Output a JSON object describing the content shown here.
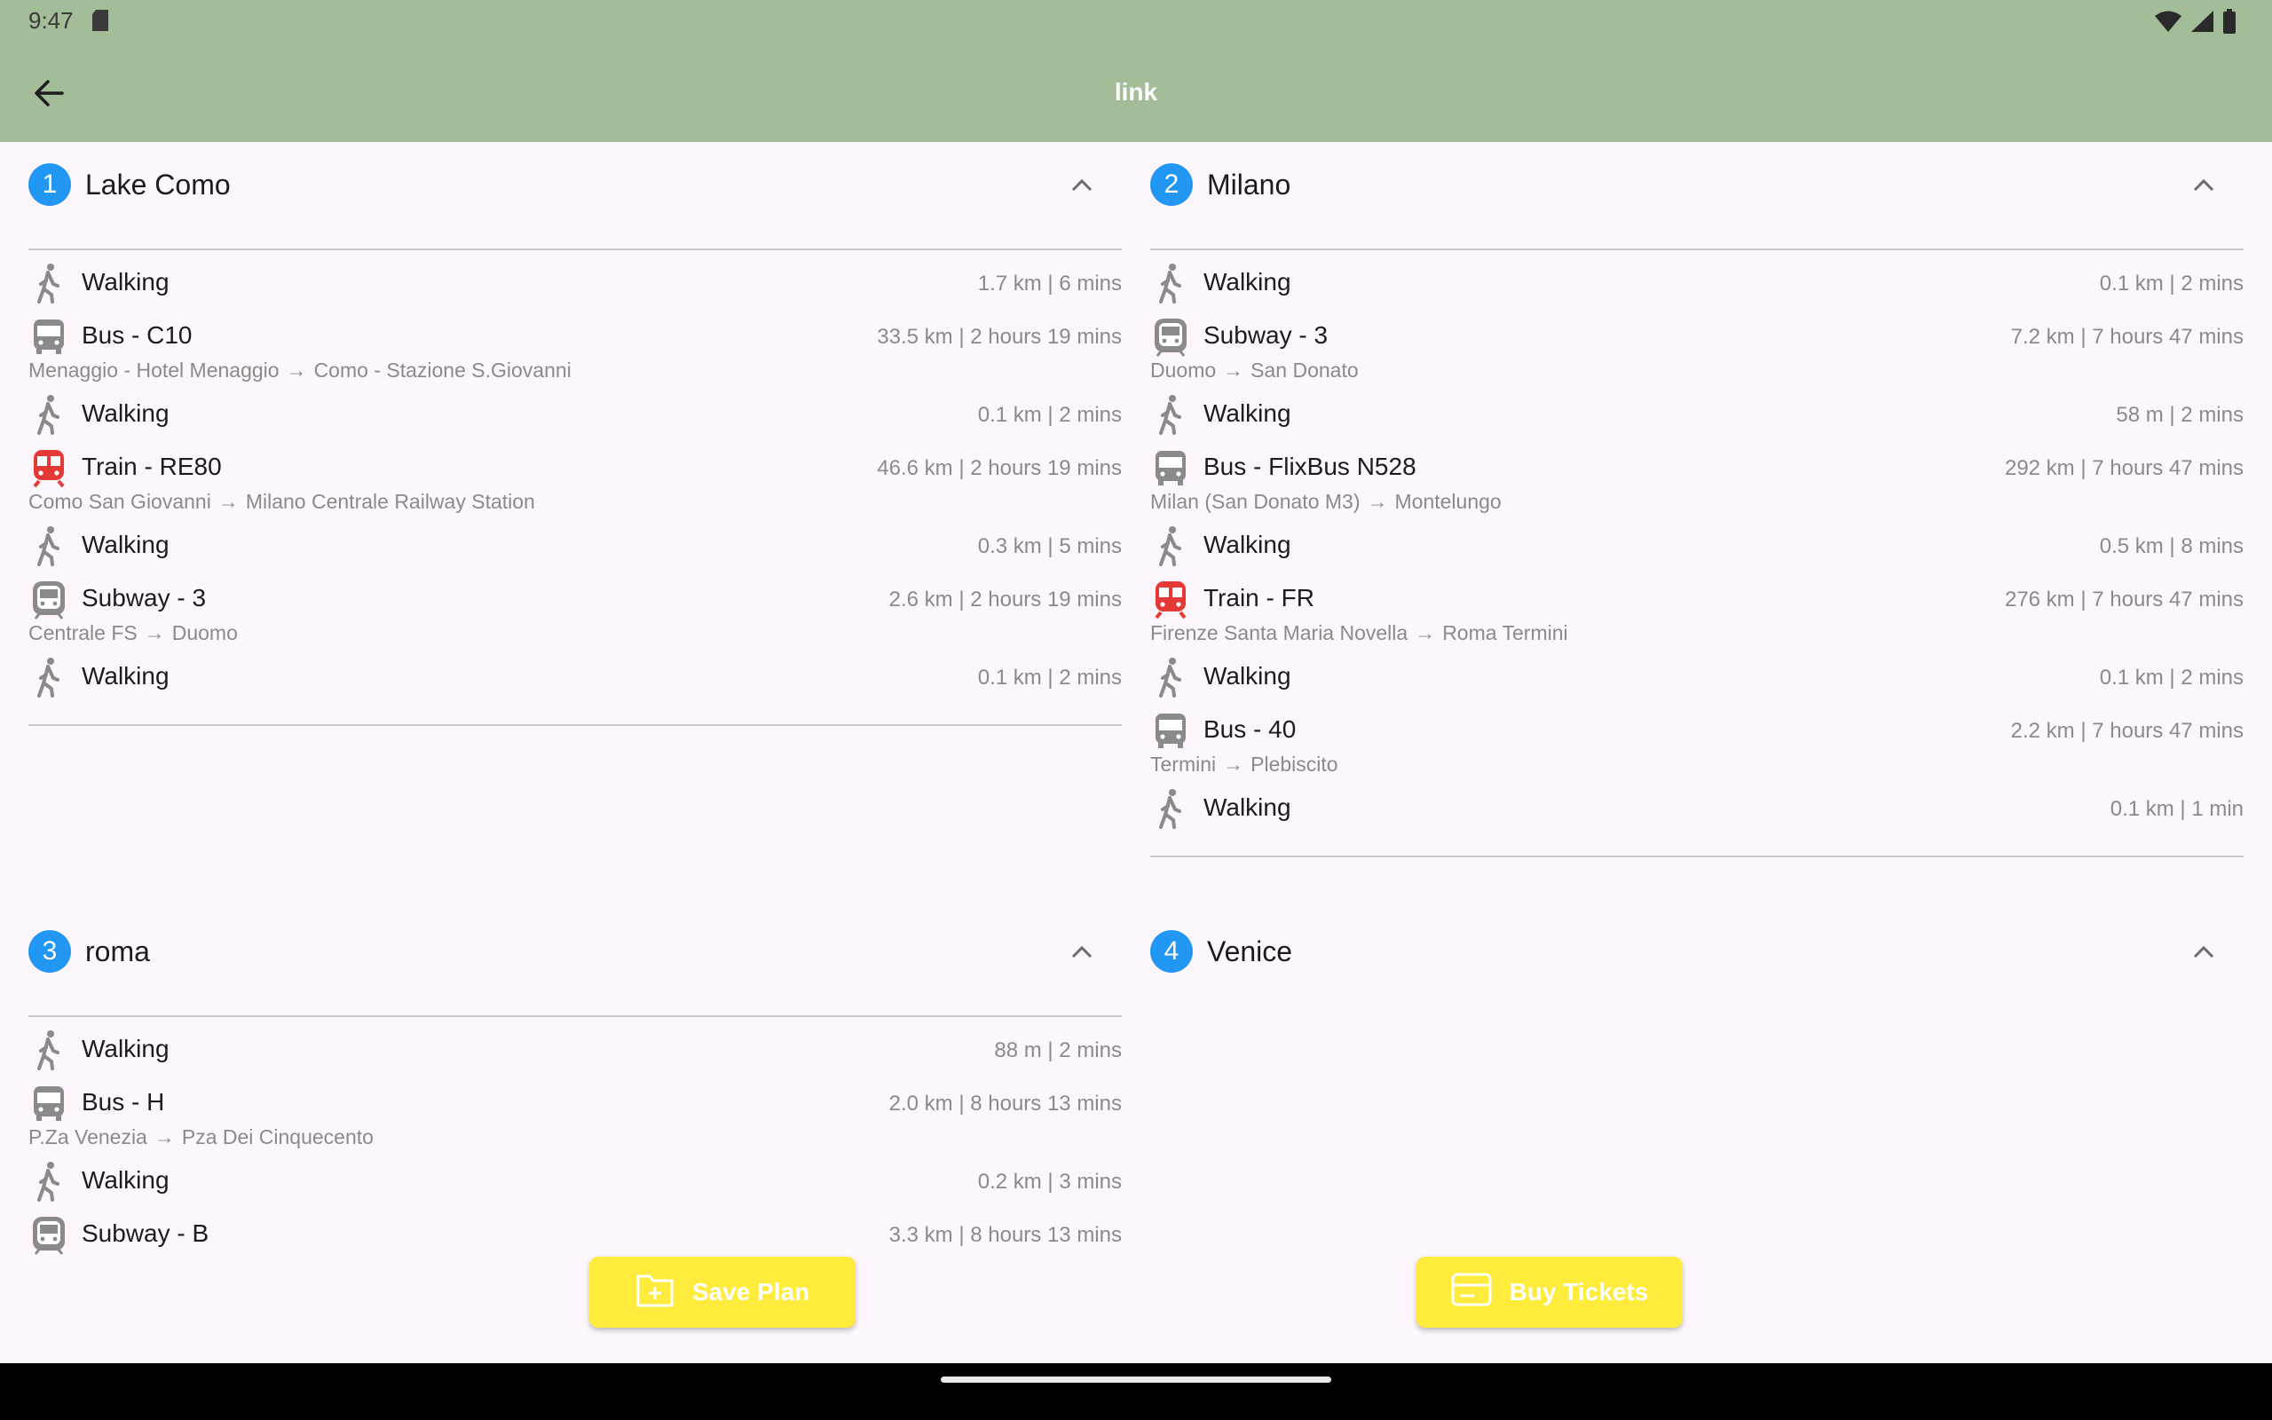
{
  "status_bar": {
    "time": "9:47"
  },
  "app_bar": {
    "title": "link"
  },
  "sections": [
    {
      "number": "1",
      "title": "Lake Como",
      "legs": [
        {
          "icon": "walk-icon",
          "label": "Walking",
          "meta": "1.7 km | 6 mins"
        },
        {
          "icon": "bus-icon",
          "label": "Bus - C10",
          "meta": "33.5 km | 2 hours 19 mins",
          "from": "Menaggio - Hotel Menaggio",
          "to": "Como - Stazione S.Giovanni"
        },
        {
          "icon": "walk-icon",
          "label": "Walking",
          "meta": "0.1 km | 2 mins"
        },
        {
          "icon": "train-icon",
          "label": "Train - RE80",
          "meta": "46.6 km | 2 hours 19 mins",
          "from": "Como San Giovanni",
          "to": "Milano Centrale Railway Station"
        },
        {
          "icon": "walk-icon",
          "label": "Walking",
          "meta": "0.3 km | 5 mins"
        },
        {
          "icon": "subway-icon",
          "label": "Subway - 3",
          "meta": "2.6 km | 2 hours 19 mins",
          "from": "Centrale FS",
          "to": "Duomo"
        },
        {
          "icon": "walk-icon",
          "label": "Walking",
          "meta": "0.1 km | 2 mins"
        }
      ]
    },
    {
      "number": "2",
      "title": "Milano",
      "legs": [
        {
          "icon": "walk-icon",
          "label": "Walking",
          "meta": "0.1 km | 2 mins"
        },
        {
          "icon": "subway-icon",
          "label": "Subway - 3",
          "meta": "7.2 km | 7 hours 47 mins",
          "from": "Duomo",
          "to": "San Donato"
        },
        {
          "icon": "walk-icon",
          "label": "Walking",
          "meta": "58 m | 2 mins"
        },
        {
          "icon": "bus-icon",
          "label": "Bus - FlixBus N528",
          "meta": "292 km | 7 hours 47 mins",
          "from": "Milan (San Donato M3)",
          "to": "Montelungo"
        },
        {
          "icon": "walk-icon",
          "label": "Walking",
          "meta": "0.5 km | 8 mins"
        },
        {
          "icon": "train-icon",
          "label": "Train - FR",
          "meta": "276 km | 7 hours 47 mins",
          "from": "Firenze Santa Maria Novella",
          "to": "Roma Termini"
        },
        {
          "icon": "walk-icon",
          "label": "Walking",
          "meta": "0.1 km | 2 mins"
        },
        {
          "icon": "bus-icon",
          "label": "Bus - 40",
          "meta": "2.2 km | 7 hours 47 mins",
          "from": "Termini",
          "to": "Plebiscito"
        },
        {
          "icon": "walk-icon",
          "label": "Walking",
          "meta": "0.1 km | 1 min"
        }
      ]
    },
    {
      "number": "3",
      "title": "roma",
      "legs": [
        {
          "icon": "walk-icon",
          "label": "Walking",
          "meta": "88 m | 2 mins"
        },
        {
          "icon": "bus-icon",
          "label": "Bus - H",
          "meta": "2.0 km | 8 hours 13 mins",
          "from": "P.Za Venezia",
          "to": "Pza Dei Cinquecento"
        },
        {
          "icon": "walk-icon",
          "label": "Walking",
          "meta": "0.2 km | 3 mins"
        },
        {
          "icon": "subway-icon",
          "label": "Subway - B",
          "meta": "3.3 km | 8 hours 13 mins"
        }
      ]
    },
    {
      "number": "4",
      "title": "Venice",
      "legs": []
    }
  ],
  "actions": {
    "save_plan": "Save Plan",
    "buy_tickets": "Buy Tickets"
  },
  "colors": {
    "app_bar": "#a2bd97",
    "background": "#fdf7fd",
    "badge": "#2196f3",
    "train_icon": "#e53935",
    "transit_icon": "#8a8a8a",
    "action_button": "#ffeb3b"
  },
  "route_arrow": "→"
}
